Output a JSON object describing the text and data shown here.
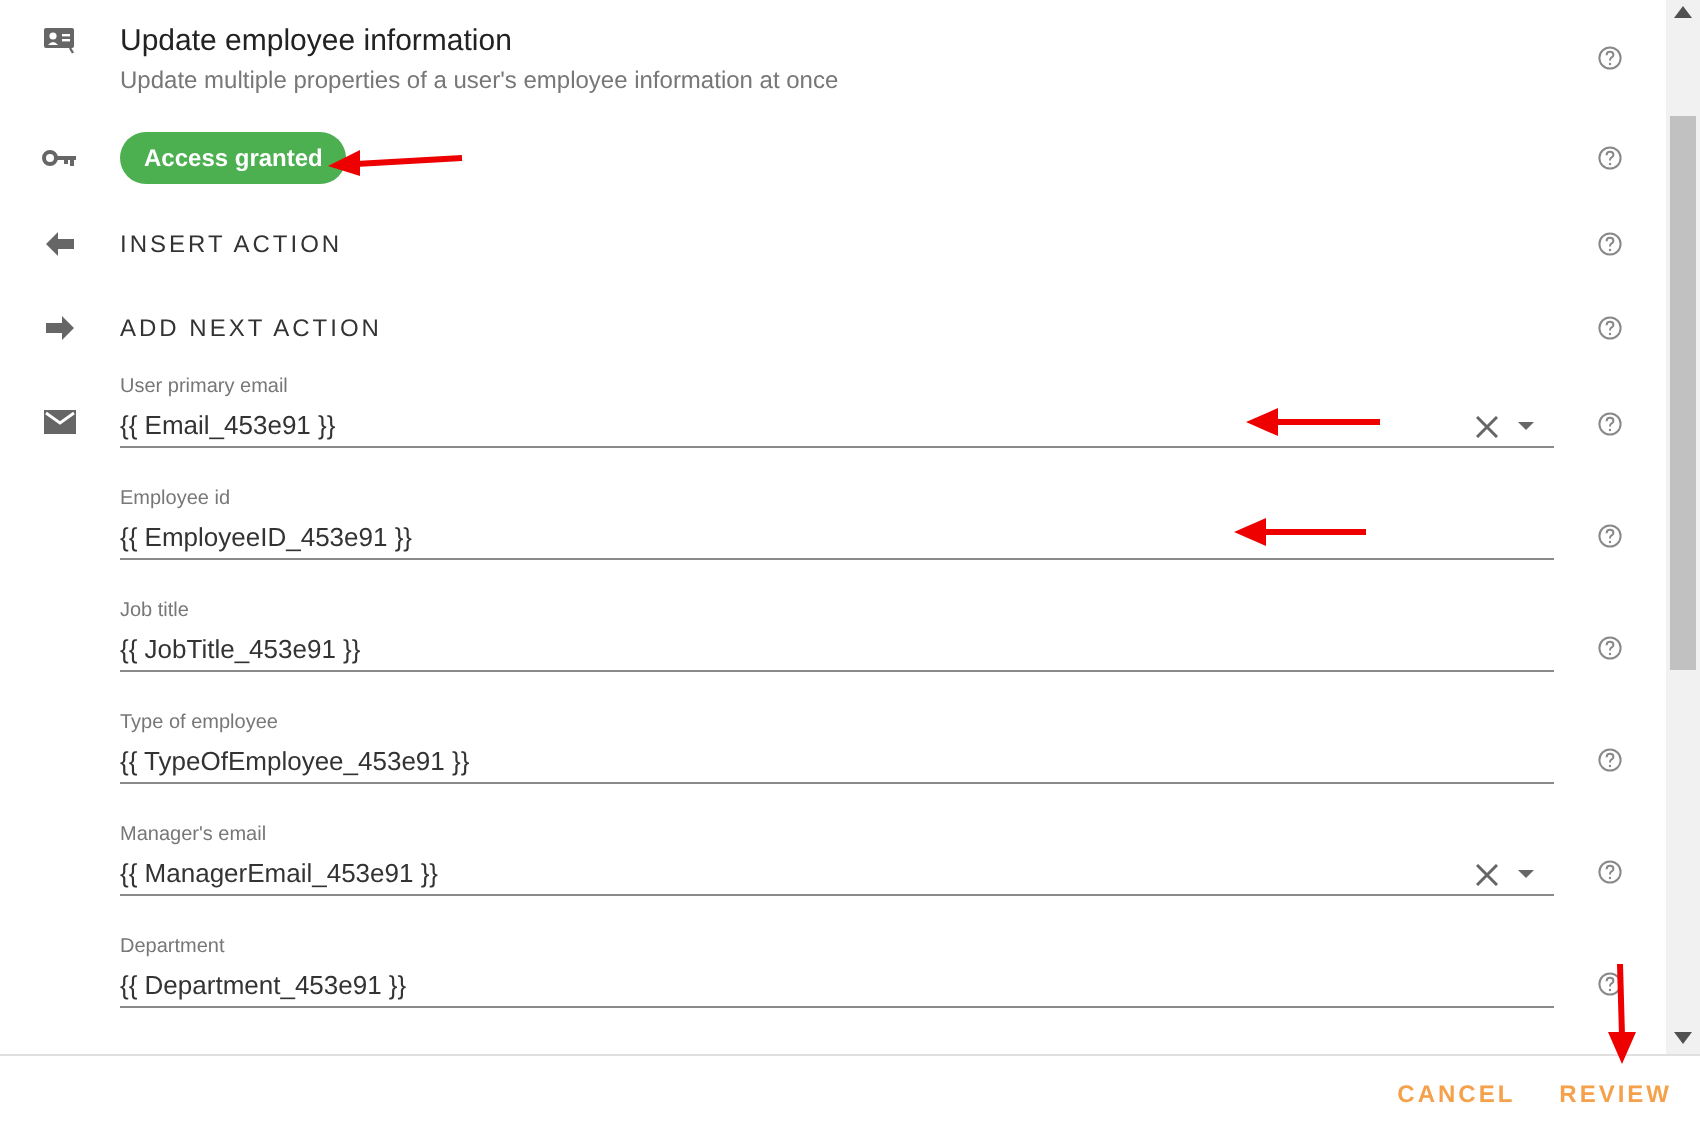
{
  "header": {
    "title": "Update employee information",
    "description": "Update multiple properties of a user's employee information at once"
  },
  "access": {
    "label": "Access granted",
    "granted": true
  },
  "actions": [
    {
      "kind": "insert",
      "label": "INSERT ACTION"
    },
    {
      "kind": "next",
      "label": "ADD NEXT ACTION"
    }
  ],
  "fields": [
    {
      "label": "User primary email",
      "value": "{{ Email_453e91 }}",
      "kind": "select"
    },
    {
      "label": "Employee id",
      "value": "{{ EmployeeID_453e91 }}",
      "kind": "text"
    },
    {
      "label": "Job title",
      "value": "{{ JobTitle_453e91 }}",
      "kind": "text"
    },
    {
      "label": "Type of employee",
      "value": "{{ TypeOfEmployee_453e91 }}",
      "kind": "text"
    },
    {
      "label": "Manager's email",
      "value": "{{ ManagerEmail_453e91 }}",
      "kind": "select"
    },
    {
      "label": "Department",
      "value": "{{ Department_453e91 }}",
      "kind": "text"
    }
  ],
  "footer": {
    "buttons": [
      "CANCEL",
      "REVIEW"
    ]
  }
}
